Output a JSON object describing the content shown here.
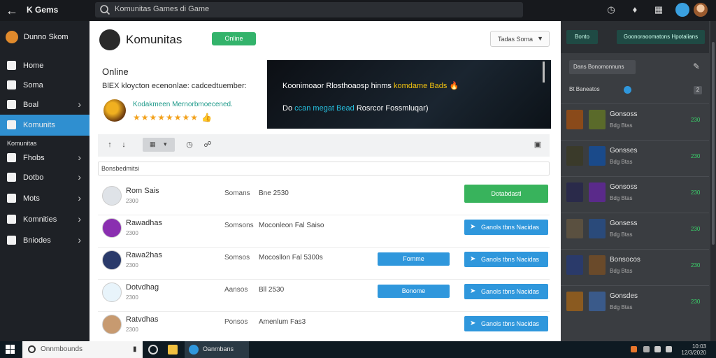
{
  "header": {
    "brand": "K Gems",
    "search_placeholder": "Komunitas Games di Game"
  },
  "sidebar": {
    "user_name": "Dunno Skom",
    "items": [
      {
        "label": "Home",
        "has_chevron": false
      },
      {
        "label": "Soma",
        "has_chevron": false
      },
      {
        "label": "Boal",
        "has_chevron": true
      },
      {
        "label": "Komunits",
        "has_chevron": false,
        "active": true
      },
      {
        "label": "Fhobs",
        "has_chevron": true
      },
      {
        "label": "Dotbo",
        "has_chevron": true
      },
      {
        "label": "Mots",
        "has_chevron": true
      },
      {
        "label": "Komnities",
        "has_chevron": true
      },
      {
        "label": "Bniodes",
        "has_chevron": true
      }
    ],
    "section_label": "Komunitas"
  },
  "main": {
    "title": "Komunitas",
    "online_badge": "Online",
    "dropdown_value": "Tadas Soma",
    "info": {
      "heading": "Online",
      "description": "BlEX kloycton ecenonlae: cadcedtuember:",
      "link_text": "Kodakmeen Mernorbmoecened.",
      "stars": "★★★★★★★★",
      "star_suffix": "👍"
    },
    "banner": {
      "line1": "Koonimoaor Rlosthoaosp hinms",
      "line1_highlight": "komdame Bads",
      "line1_emoji": "🔥",
      "line2_prefix": "Do",
      "line2_highlight": "ccan megat Bead",
      "line2_suffix": "Rosrcor Fossmluqar)"
    },
    "filter_text": "Bonsbedmitsi",
    "rows": [
      {
        "name": "Rom Sais",
        "sub": "2300",
        "col1": "Somans",
        "col2": "Bne 2530",
        "mid_button": "",
        "action": "Dotabdastl",
        "action_style": "green",
        "avatar": "#dfe3e8"
      },
      {
        "name": "Rawadhas",
        "sub": "2300",
        "col1": "Somsons",
        "col2": "Moconleon Fal Saiso",
        "mid_button": "",
        "action": "Ganols tbns Nacidas",
        "action_style": "blue",
        "avatar": "#8a2fb0"
      },
      {
        "name": "Rawa2has",
        "sub": "2300",
        "col1": "Somsos",
        "col2": "Mocosllon Fal 5300s",
        "mid_button": "Fomme",
        "action": "Ganols tbns Nacidas",
        "action_style": "blue",
        "avatar": "#2a3a6a"
      },
      {
        "name": "Dotvdhag",
        "sub": "2300",
        "col1": "Aansos",
        "col2": "Bll 2530",
        "mid_button": "Bonome",
        "action": "Ganols tbns Nacidas",
        "action_style": "blue",
        "avatar": "#e8f4fb"
      },
      {
        "name": "Ratvdhas",
        "sub": "2300",
        "col1": "Ponsos",
        "col2": "Amenlum Fas3",
        "mid_button": "",
        "action": "Ganols tbns Nacidas",
        "action_style": "blue",
        "avatar": "#c79a70"
      }
    ]
  },
  "right_panel": {
    "button1": "Bonto",
    "button2": "Goonoraoomatons Hpotalians",
    "search_text": "Dans Bonomonnuns",
    "sub_label": "Bt Baneatos",
    "count": "2",
    "rows": [
      {
        "name": "Gonsoss",
        "sub": "Bdg Btas",
        "count": "230"
      },
      {
        "name": "Gonsses",
        "sub": "Bdg Btas",
        "count": "230"
      },
      {
        "name": "Gonsoss",
        "sub": "Bdg Btas",
        "count": "230"
      },
      {
        "name": "Gonsess",
        "sub": "Bdg Btas",
        "count": "230"
      },
      {
        "name": "Bonsocos",
        "sub": "Bdg Btas",
        "count": "230"
      },
      {
        "name": "Gonsdes",
        "sub": "Bdg Btas",
        "count": "230"
      }
    ]
  },
  "taskbar": {
    "search_text": "Onnmbounds",
    "app_label": "Oanmbans",
    "clock_time": "10:03",
    "clock_date": "12/3/2020"
  },
  "colors": {
    "accent_blue": "#2f97dc",
    "accent_green": "#38b35c",
    "sidebar_active": "#2f8fd0"
  }
}
